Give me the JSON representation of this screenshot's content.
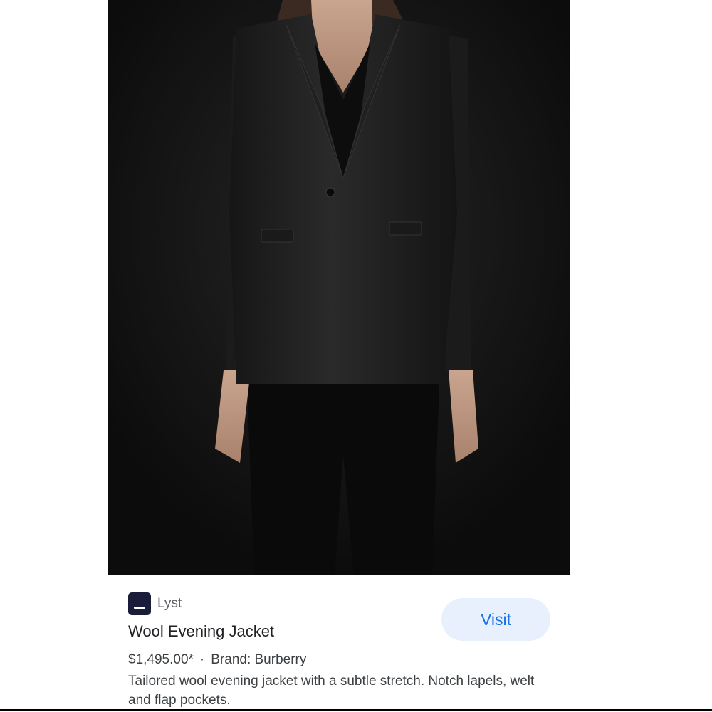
{
  "result": {
    "image_alt": "Woman wearing a black tailored wool evening jacket",
    "source": {
      "name": "Lyst",
      "logo_icon": "lyst-logo-icon",
      "logo_color": "#1a1d3a"
    },
    "title": "Wool Evening Jacket",
    "price": "$1,495.00*",
    "separator": "·",
    "brand": "Brand: Burberry",
    "description": "Tailored wool evening jacket with a subtle stretch. Notch lapels, welt and flap pockets.",
    "visit_label": "Visit",
    "accent_color": "#1a73e8"
  }
}
